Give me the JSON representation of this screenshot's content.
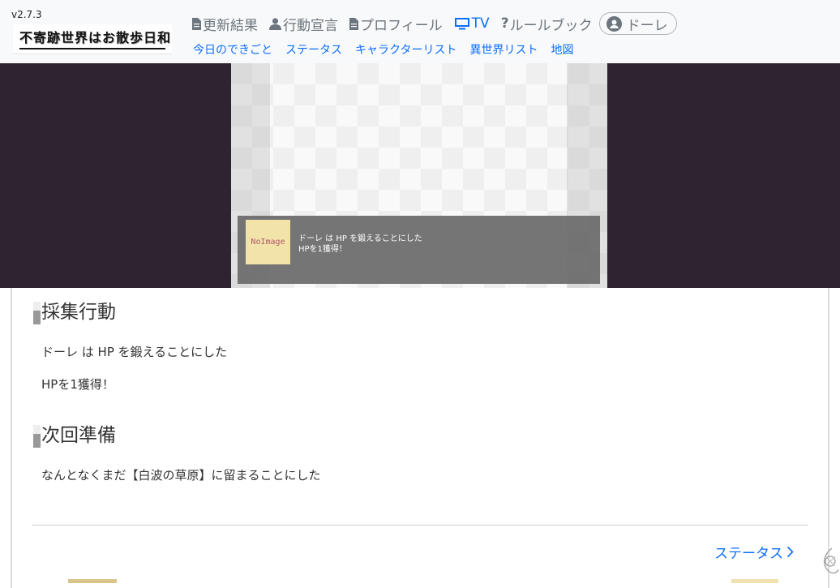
{
  "header": {
    "version": "v2.7.3",
    "logo_text": "不寄跡世界はお散歩日和",
    "nav": [
      {
        "label": "更新結果",
        "icon": "document-icon",
        "active": false
      },
      {
        "label": "行動宣言",
        "icon": "person-icon",
        "active": false
      },
      {
        "label": "プロフィール",
        "icon": "document-icon",
        "active": false
      },
      {
        "label": "TV",
        "icon": "tv-icon",
        "active": true
      },
      {
        "label": "ルールブック",
        "icon": "question-icon",
        "active": false
      }
    ],
    "user": {
      "label": "ドーレ",
      "icon": "user-circle-icon"
    },
    "subnav": [
      "今日のできごと",
      "ステータス",
      "キャラクターリスト",
      "異世界リスト",
      "地図"
    ]
  },
  "tv": {
    "noimage_label": "NoImage",
    "message_lines": [
      "ドーレ は HP を鍛えることにした",
      "HPを1獲得！"
    ]
  },
  "content": {
    "sections": [
      {
        "title": "採集行動",
        "paragraphs": [
          "ドーレ は HP を鍛えることにした",
          "HPを1獲得！"
        ]
      },
      {
        "title": "次回準備",
        "paragraphs": [
          "なんとなくまだ【白波の草原】に留まることにした"
        ]
      }
    ],
    "status_link": "ステータス"
  },
  "colors": {
    "accent": "#0d6efd",
    "tv_band": "#2e2330",
    "nav_muted": "#6c757d"
  }
}
